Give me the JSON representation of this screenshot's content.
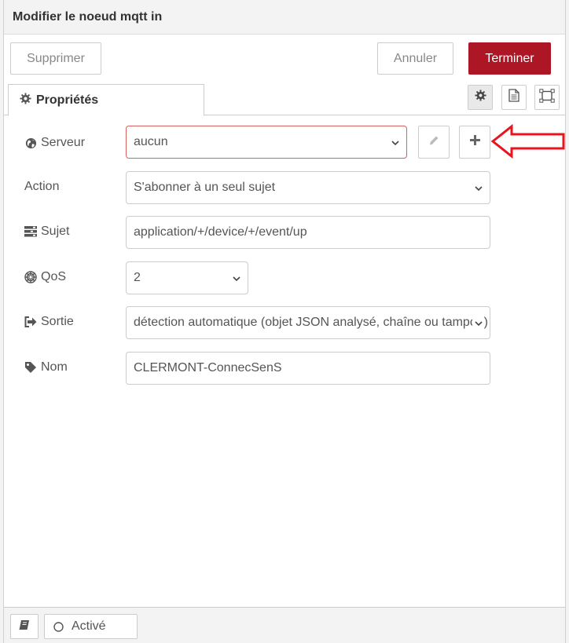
{
  "header": {
    "title": "Modifier le noeud mqtt in",
    "delete_label": "Supprimer",
    "cancel_label": "Annuler",
    "done_label": "Terminer"
  },
  "tabs": {
    "properties_label": "Propriétés"
  },
  "icons": {
    "tab": "gear-icon",
    "side": [
      "gear-icon",
      "document-icon",
      "frame-icon"
    ],
    "server": "globe-icon",
    "topic": "tasks-icon",
    "qos": "empire-icon",
    "output": "sign-out-icon",
    "name": "tag-icon",
    "edit_server": "pencil-icon",
    "add_server": "plus-icon",
    "footer_book": "book-icon",
    "enabled": "circle-icon"
  },
  "form": {
    "server": {
      "label": "Serveur",
      "value": "aucun"
    },
    "action": {
      "label": "Action",
      "value": "S'abonner à un seul sujet"
    },
    "topic": {
      "label": "Sujet",
      "value": "application/+/device/+/event/up"
    },
    "qos": {
      "label": "QoS",
      "value": "2"
    },
    "output": {
      "label": "Sortie",
      "value": "détection automatique (objet JSON analysé, chaîne ou tampon)"
    },
    "name": {
      "label": "Nom",
      "value": "CLERMONT-ConnecSenS"
    }
  },
  "footer": {
    "enabled_label": "Activé"
  },
  "colors": {
    "primary": "#ad1625",
    "error_border": "#d6615f",
    "annotation_arrow": "#e8141e"
  }
}
